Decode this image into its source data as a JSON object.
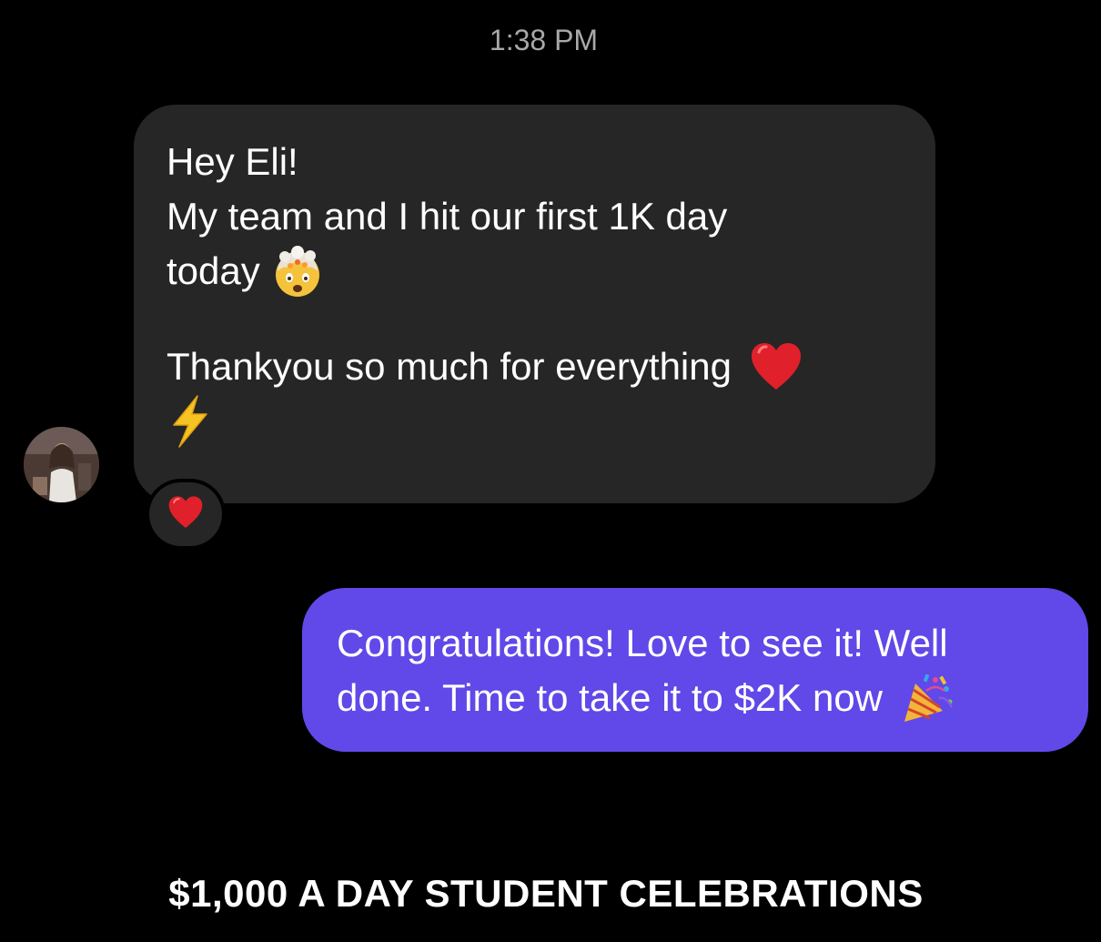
{
  "conversation": {
    "timestamp": "1:38 PM",
    "incoming_message": {
      "lines": [
        "Hey Eli!",
        "My team and I hit our first 1K day",
        "today",
        "Thankyou so much for everything"
      ],
      "emojis": [
        "exploding-head-emoji",
        "red-heart-emoji",
        "high-voltage-emoji"
      ],
      "reaction": "red-heart-emoji"
    },
    "outgoing_message": {
      "lines": [
        "Congratulations! Love to see it! Well",
        "done. Time to take it to $2K now"
      ],
      "emojis": [
        "party-popper-emoji"
      ]
    }
  },
  "caption": "$1,000 A DAY STUDENT CELEBRATIONS",
  "colors": {
    "background": "#000000",
    "incoming_bubble": "#262626",
    "outgoing_bubble": "#6148e8",
    "timestamp_text": "#a8a8a8",
    "heart": "#e0202a"
  }
}
